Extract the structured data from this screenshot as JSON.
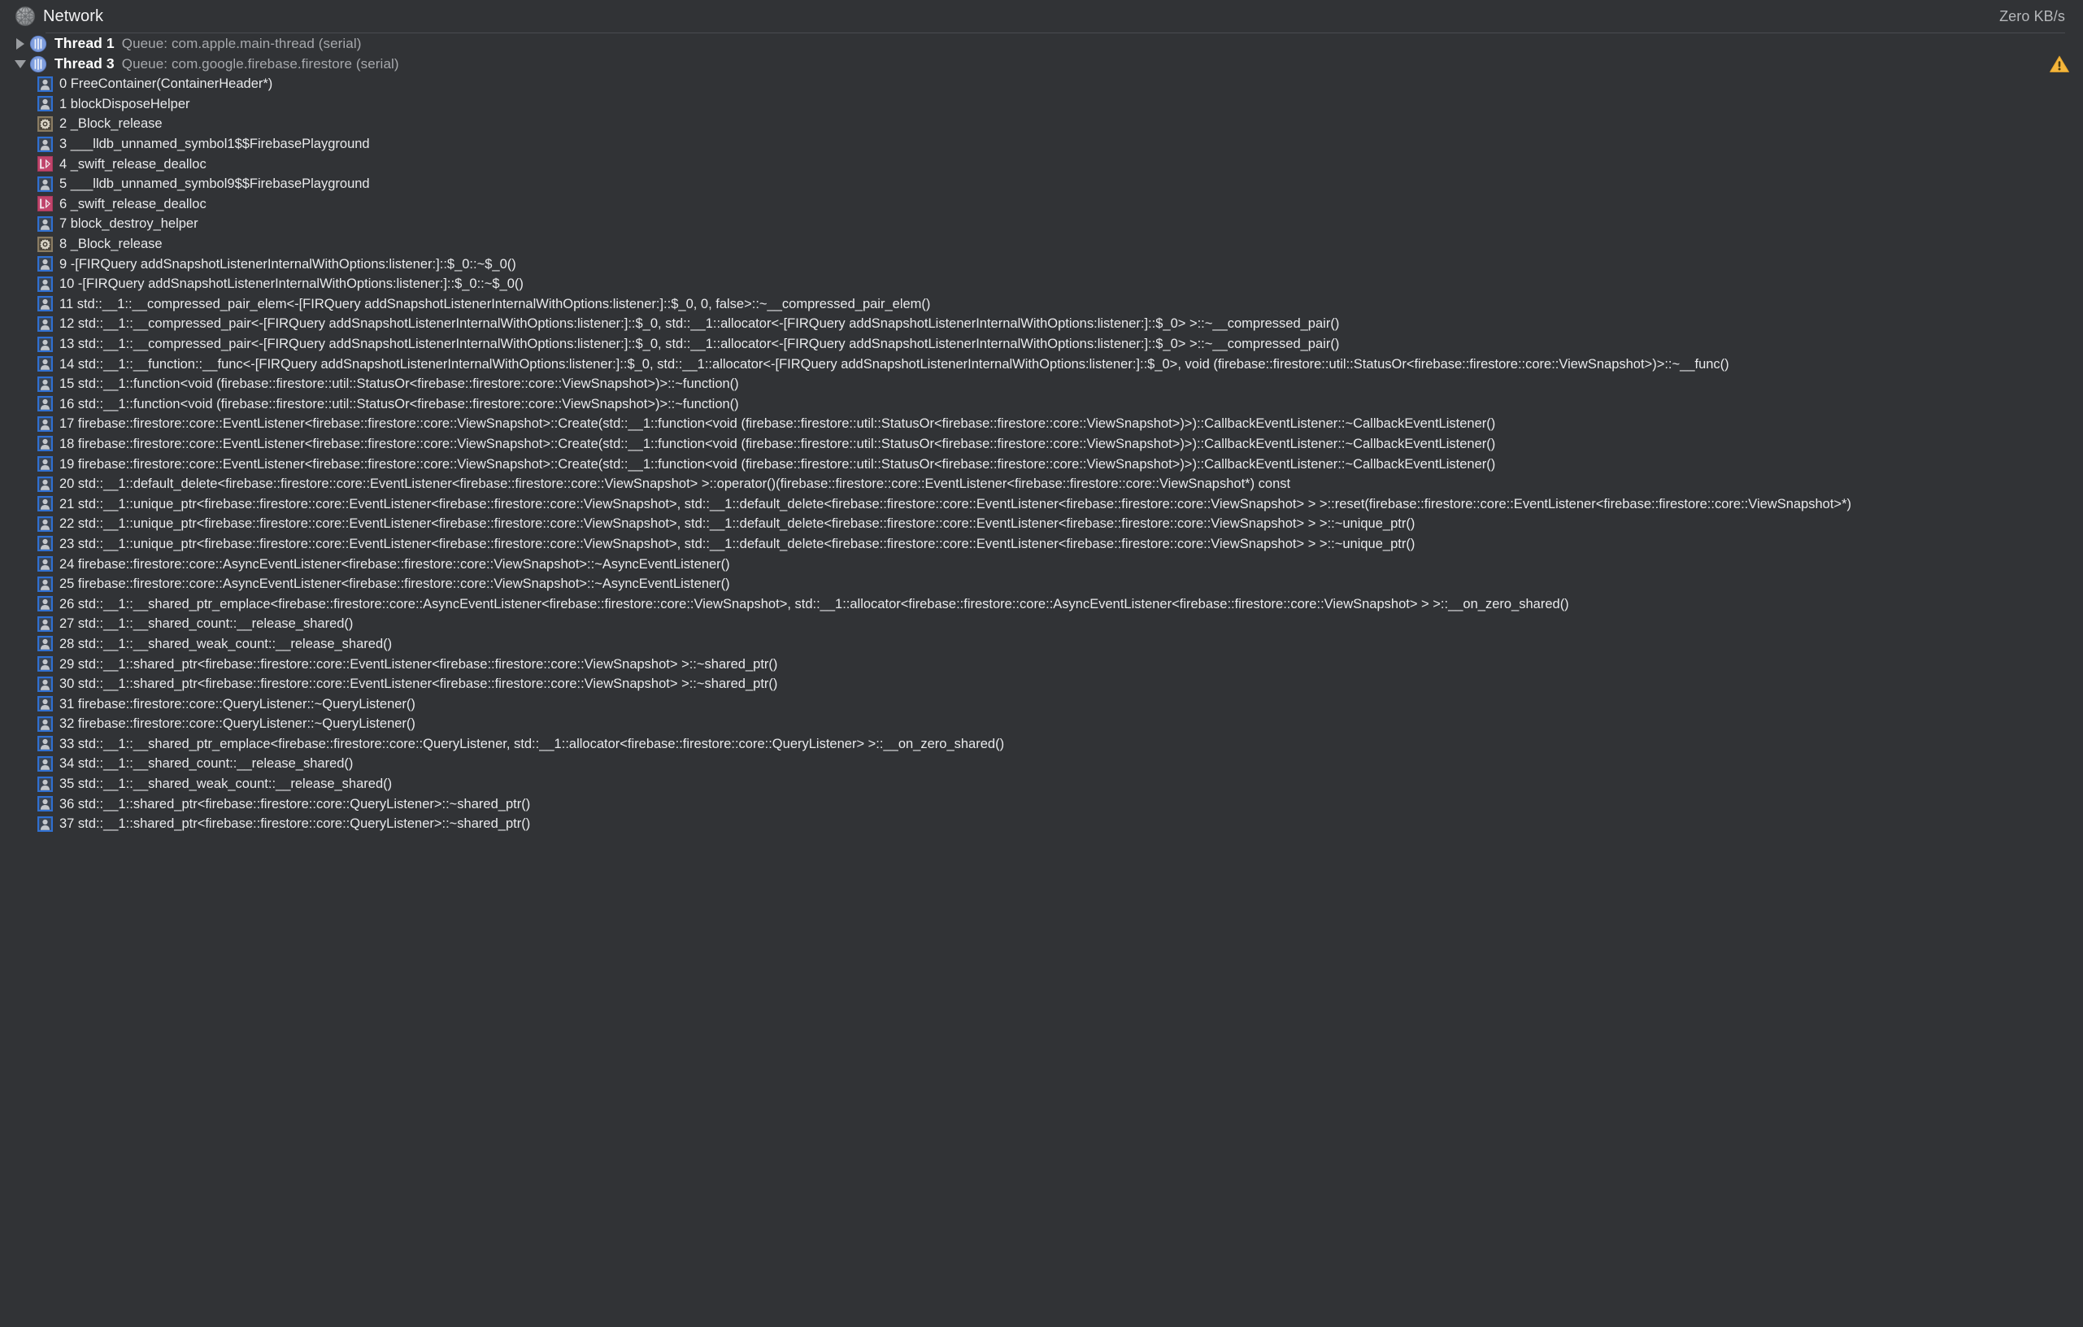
{
  "topbar": {
    "title": "Network",
    "icon": "network-globe-icon",
    "rate": "Zero KB/s"
  },
  "threads": [
    {
      "expanded": false,
      "name": "Thread 1",
      "queue": "Queue: com.apple.main-thread (serial)",
      "warning": false,
      "frames": []
    },
    {
      "expanded": true,
      "name": "Thread 3",
      "queue": "Queue: com.google.firebase.firestore (serial)",
      "warning": true,
      "frames": [
        {
          "icon": "user-code-icon",
          "text": "0 FreeContainer(ContainerHeader*)"
        },
        {
          "icon": "user-code-icon",
          "text": "1 blockDisposeHelper"
        },
        {
          "icon": "system-gear-icon",
          "text": "2 _Block_release"
        },
        {
          "icon": "user-code-icon",
          "text": "3 ___lldb_unnamed_symbol1$$FirebasePlayground"
        },
        {
          "icon": "swift-icon",
          "text": "4 _swift_release_dealloc"
        },
        {
          "icon": "user-code-icon",
          "text": "5 ___lldb_unnamed_symbol9$$FirebasePlayground"
        },
        {
          "icon": "swift-icon",
          "text": "6 _swift_release_dealloc"
        },
        {
          "icon": "user-code-icon",
          "text": "7 block_destroy_helper"
        },
        {
          "icon": "system-gear-icon",
          "text": "8 _Block_release"
        },
        {
          "icon": "user-code-icon",
          "text": "9 -[FIRQuery addSnapshotListenerInternalWithOptions:listener:]::$_0::~$_0()"
        },
        {
          "icon": "user-code-icon",
          "text": "10 -[FIRQuery addSnapshotListenerInternalWithOptions:listener:]::$_0::~$_0()"
        },
        {
          "icon": "user-code-icon",
          "text": "11 std::__1::__compressed_pair_elem<-[FIRQuery addSnapshotListenerInternalWithOptions:listener:]::$_0, 0, false>::~__compressed_pair_elem()"
        },
        {
          "icon": "user-code-icon",
          "text": "12 std::__1::__compressed_pair<-[FIRQuery addSnapshotListenerInternalWithOptions:listener:]::$_0, std::__1::allocator<-[FIRQuery addSnapshotListenerInternalWithOptions:listener:]::$_0> >::~__compressed_pair()"
        },
        {
          "icon": "user-code-icon",
          "text": "13 std::__1::__compressed_pair<-[FIRQuery addSnapshotListenerInternalWithOptions:listener:]::$_0, std::__1::allocator<-[FIRQuery addSnapshotListenerInternalWithOptions:listener:]::$_0> >::~__compressed_pair()"
        },
        {
          "icon": "user-code-icon",
          "text": "14 std::__1::__function::__func<-[FIRQuery addSnapshotListenerInternalWithOptions:listener:]::$_0, std::__1::allocator<-[FIRQuery addSnapshotListenerInternalWithOptions:listener:]::$_0>, void (firebase::firestore::util::StatusOr<firebase::firestore::core::ViewSnapshot>)>::~__func()"
        },
        {
          "icon": "user-code-icon",
          "text": "15 std::__1::function<void (firebase::firestore::util::StatusOr<firebase::firestore::core::ViewSnapshot>)>::~function()"
        },
        {
          "icon": "user-code-icon",
          "text": "16 std::__1::function<void (firebase::firestore::util::StatusOr<firebase::firestore::core::ViewSnapshot>)>::~function()"
        },
        {
          "icon": "user-code-icon",
          "text": "17 firebase::firestore::core::EventListener<firebase::firestore::core::ViewSnapshot>::Create(std::__1::function<void (firebase::firestore::util::StatusOr<firebase::firestore::core::ViewSnapshot>)>)::CallbackEventListener::~CallbackEventListener()"
        },
        {
          "icon": "user-code-icon",
          "text": "18 firebase::firestore::core::EventListener<firebase::firestore::core::ViewSnapshot>::Create(std::__1::function<void (firebase::firestore::util::StatusOr<firebase::firestore::core::ViewSnapshot>)>)::CallbackEventListener::~CallbackEventListener()"
        },
        {
          "icon": "user-code-icon",
          "text": "19 firebase::firestore::core::EventListener<firebase::firestore::core::ViewSnapshot>::Create(std::__1::function<void (firebase::firestore::util::StatusOr<firebase::firestore::core::ViewSnapshot>)>)::CallbackEventListener::~CallbackEventListener()"
        },
        {
          "icon": "user-code-icon",
          "text": "20 std::__1::default_delete<firebase::firestore::core::EventListener<firebase::firestore::core::ViewSnapshot> >::operator()(firebase::firestore::core::EventListener<firebase::firestore::core::ViewSnapshot*) const"
        },
        {
          "icon": "user-code-icon",
          "text": "21 std::__1::unique_ptr<firebase::firestore::core::EventListener<firebase::firestore::core::ViewSnapshot>, std::__1::default_delete<firebase::firestore::core::EventListener<firebase::firestore::core::ViewSnapshot> > >::reset(firebase::firestore::core::EventListener<firebase::firestore::core::ViewSnapshot>*)"
        },
        {
          "icon": "user-code-icon",
          "text": "22 std::__1::unique_ptr<firebase::firestore::core::EventListener<firebase::firestore::core::ViewSnapshot>, std::__1::default_delete<firebase::firestore::core::EventListener<firebase::firestore::core::ViewSnapshot> > >::~unique_ptr()"
        },
        {
          "icon": "user-code-icon",
          "text": "23 std::__1::unique_ptr<firebase::firestore::core::EventListener<firebase::firestore::core::ViewSnapshot>, std::__1::default_delete<firebase::firestore::core::EventListener<firebase::firestore::core::ViewSnapshot> > >::~unique_ptr()"
        },
        {
          "icon": "user-code-icon",
          "text": "24 firebase::firestore::core::AsyncEventListener<firebase::firestore::core::ViewSnapshot>::~AsyncEventListener()"
        },
        {
          "icon": "user-code-icon",
          "text": "25 firebase::firestore::core::AsyncEventListener<firebase::firestore::core::ViewSnapshot>::~AsyncEventListener()"
        },
        {
          "icon": "user-code-icon",
          "text": "26 std::__1::__shared_ptr_emplace<firebase::firestore::core::AsyncEventListener<firebase::firestore::core::ViewSnapshot>, std::__1::allocator<firebase::firestore::core::AsyncEventListener<firebase::firestore::core::ViewSnapshot> > >::__on_zero_shared()"
        },
        {
          "icon": "user-code-icon",
          "text": "27 std::__1::__shared_count::__release_shared()"
        },
        {
          "icon": "user-code-icon",
          "text": "28 std::__1::__shared_weak_count::__release_shared()"
        },
        {
          "icon": "user-code-icon",
          "text": "29 std::__1::shared_ptr<firebase::firestore::core::EventListener<firebase::firestore::core::ViewSnapshot> >::~shared_ptr()"
        },
        {
          "icon": "user-code-icon",
          "text": "30 std::__1::shared_ptr<firebase::firestore::core::EventListener<firebase::firestore::core::ViewSnapshot> >::~shared_ptr()"
        },
        {
          "icon": "user-code-icon",
          "text": "31 firebase::firestore::core::QueryListener::~QueryListener()"
        },
        {
          "icon": "user-code-icon",
          "text": "32 firebase::firestore::core::QueryListener::~QueryListener()"
        },
        {
          "icon": "user-code-icon",
          "text": "33 std::__1::__shared_ptr_emplace<firebase::firestore::core::QueryListener, std::__1::allocator<firebase::firestore::core::QueryListener> >::__on_zero_shared()"
        },
        {
          "icon": "user-code-icon",
          "text": "34 std::__1::__shared_count::__release_shared()"
        },
        {
          "icon": "user-code-icon",
          "text": "35 std::__1::__shared_weak_count::__release_shared()"
        },
        {
          "icon": "user-code-icon",
          "text": "36 std::__1::shared_ptr<firebase::firestore::core::QueryListener>::~shared_ptr()"
        },
        {
          "icon": "user-code-icon",
          "text": "37 std::__1::shared_ptr<firebase::firestore::core::QueryListener>::~shared_ptr()"
        }
      ]
    }
  ],
  "colors": {
    "background": "#313336",
    "text": "#e9eaec",
    "muted": "#a7a9ad",
    "thread_icon": "#7a9fdb",
    "user_icon_border": "#2b6fd4",
    "swift_icon": "#c0446b",
    "gear_icon": "#8b7d63",
    "warning": "#f2b134",
    "divider": "#4a4c50"
  }
}
